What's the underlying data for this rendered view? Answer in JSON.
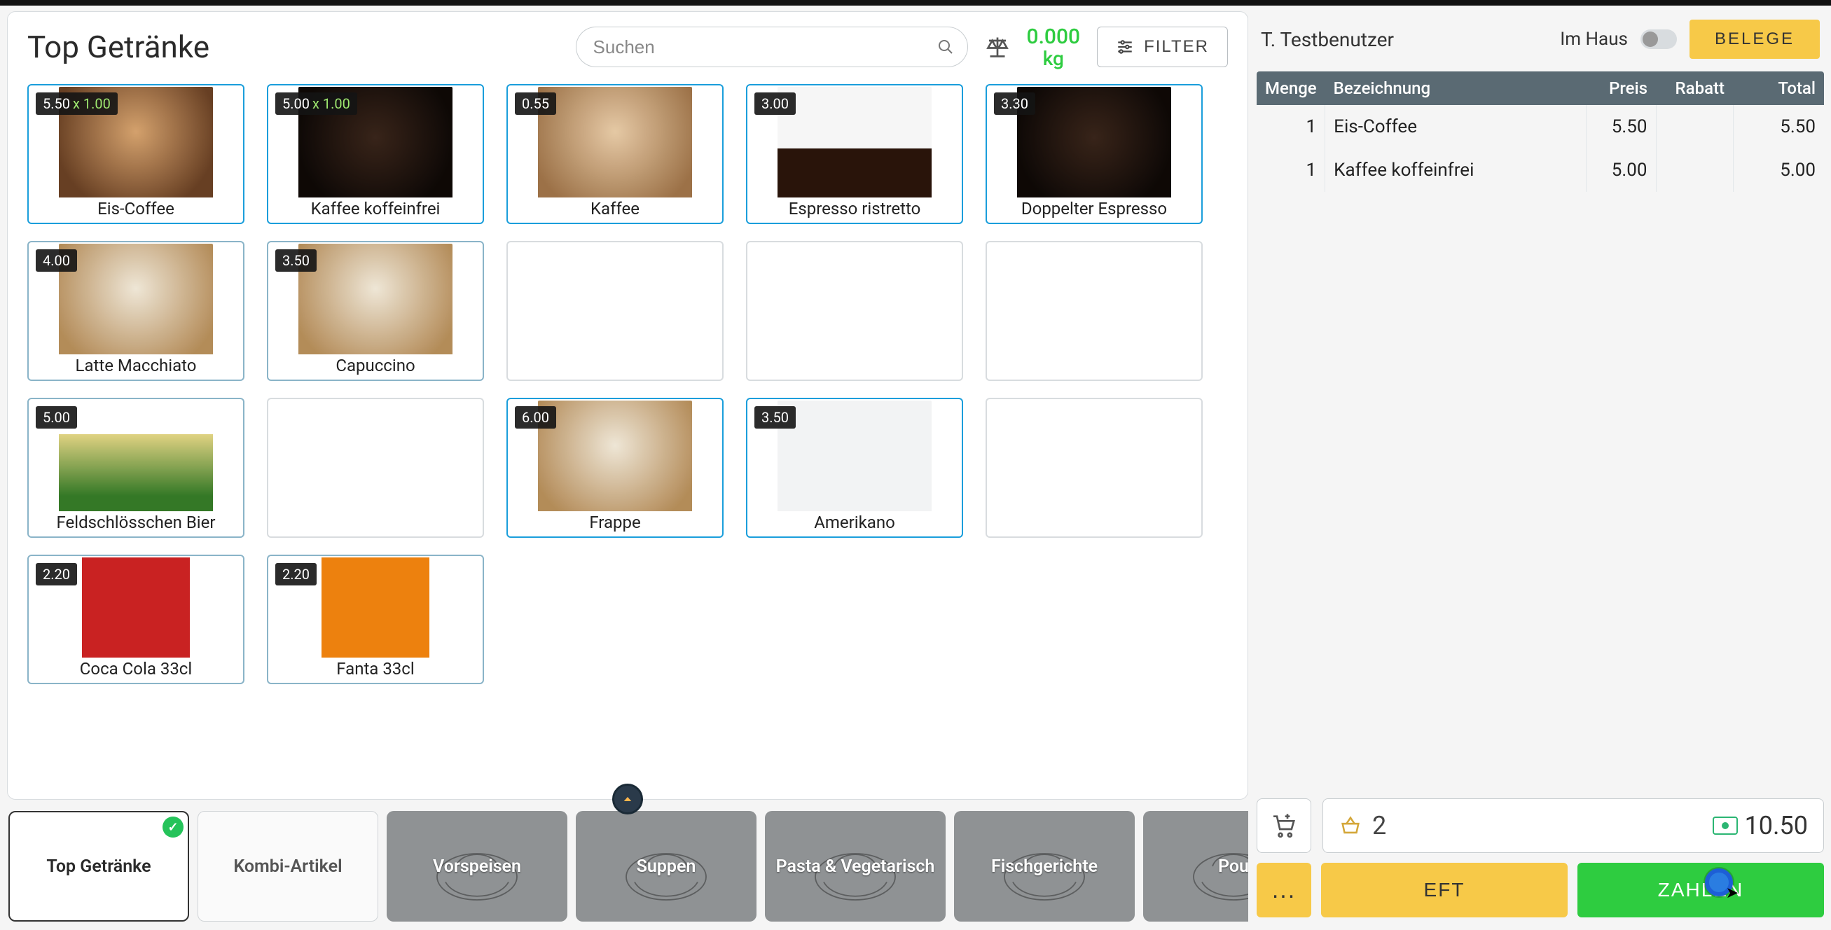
{
  "header": {
    "title": "Top Getränke",
    "search_placeholder": "Suchen",
    "weight_value": "0.000",
    "weight_unit": "kg",
    "filter_label": "FILTER"
  },
  "products": [
    {
      "price": "5.50",
      "qty": "x 1.00",
      "label": "Eis-Coffee",
      "img": "m-amber",
      "selected": true
    },
    {
      "price": "5.00",
      "qty": "x 1.00",
      "label": "Kaffee koffeinfrei",
      "img": "m-dark",
      "selected": true
    },
    {
      "price": "0.55",
      "label": "Kaffee",
      "img": "m-cream",
      "selected": true
    },
    {
      "price": "3.00",
      "label": "Espresso ristretto",
      "img": "m-shot",
      "selected": true
    },
    {
      "price": "3.30",
      "label": "Doppelter Espresso",
      "img": "m-dark",
      "selected": true
    },
    {
      "price": "4.00",
      "label": "Latte Macchiato",
      "img": "m-latte"
    },
    {
      "price": "3.50",
      "label": "Capuccino",
      "img": "m-latte"
    },
    {
      "blank": true
    },
    {
      "blank": true
    },
    {
      "blank": true
    },
    {
      "price": "5.00",
      "label": "Feldschlösschen Bier",
      "img": "m-beer"
    },
    {
      "blank": true
    },
    {
      "price": "6.00",
      "label": "Frappe",
      "img": "m-latte",
      "selected": true
    },
    {
      "price": "3.50",
      "label": "Amerikano",
      "img": "m-none",
      "selected": true
    },
    {
      "blank": true
    },
    {
      "price": "2.20",
      "label": "Coca Cola 33cl",
      "img": "m-coke",
      "cut": true
    },
    {
      "price": "2.20",
      "label": "Fanta 33cl",
      "img": "m-fanta",
      "cut": true
    }
  ],
  "categories": [
    {
      "label": "Top Getränke",
      "style": "plain",
      "active": true
    },
    {
      "label": "Kombi-Artikel",
      "style": "ghost"
    },
    {
      "label": "Vorspeisen",
      "style": "illust"
    },
    {
      "label": "Suppen",
      "style": "illust"
    },
    {
      "label": "Pasta & Vegetarisch",
      "style": "illust"
    },
    {
      "label": "Fischgerichte",
      "style": "illust"
    },
    {
      "label": "Pou",
      "style": "illust"
    }
  ],
  "order": {
    "user": "T. Testbenutzer",
    "location_label": "Im Haus",
    "belege_label": "BELEGE",
    "columns": {
      "qty": "Menge",
      "desc": "Bezeichnung",
      "price": "Preis",
      "discount": "Rabatt",
      "total": "Total"
    },
    "lines": [
      {
        "qty": "1",
        "desc": "Eis-Coffee",
        "price": "5.50",
        "discount": "",
        "total": "5.50"
      },
      {
        "qty": "1",
        "desc": "Kaffee koffeinfrei",
        "price": "5.00",
        "discount": "",
        "total": "5.00"
      }
    ],
    "summary": {
      "count": "2",
      "total": "10.50"
    },
    "actions": {
      "more": "...",
      "eft": "EFT",
      "pay": "ZAHLEN"
    }
  }
}
